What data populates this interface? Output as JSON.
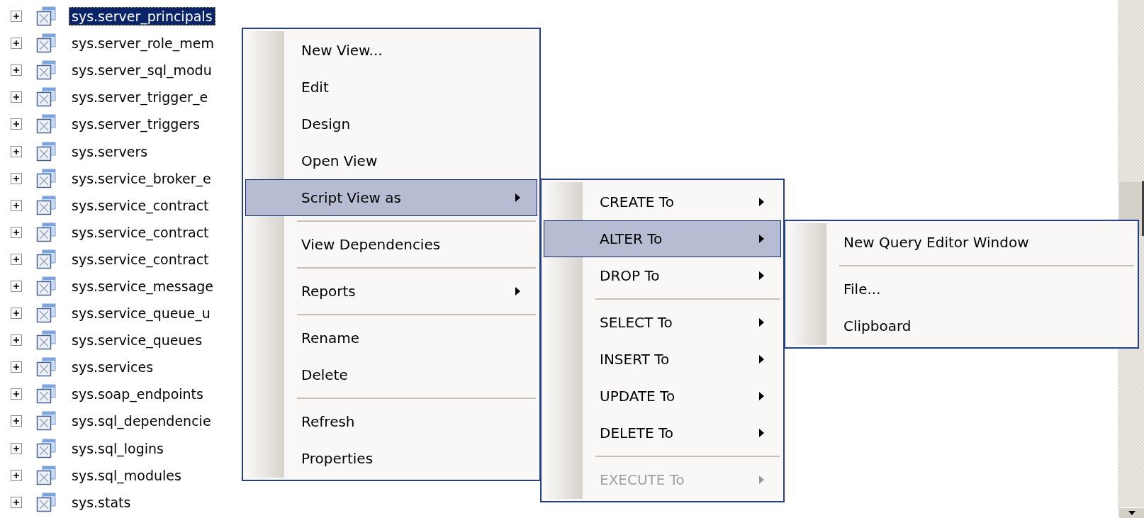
{
  "tree": {
    "rows": [
      {
        "label": "sys.server_principals",
        "selected": true
      },
      {
        "label": "sys.server_role_mem",
        "selected": false
      },
      {
        "label": "sys.server_sql_modu",
        "selected": false
      },
      {
        "label": "sys.server_trigger_e",
        "selected": false
      },
      {
        "label": "sys.server_triggers",
        "selected": false
      },
      {
        "label": "sys.servers",
        "selected": false
      },
      {
        "label": "sys.service_broker_e",
        "selected": false
      },
      {
        "label": "sys.service_contract",
        "selected": false
      },
      {
        "label": "sys.service_contract",
        "selected": false
      },
      {
        "label": "sys.service_contract",
        "selected": false
      },
      {
        "label": "sys.service_message",
        "selected": false
      },
      {
        "label": "sys.service_queue_u",
        "selected": false
      },
      {
        "label": "sys.service_queues",
        "selected": false
      },
      {
        "label": "sys.services",
        "selected": false
      },
      {
        "label": "sys.soap_endpoints",
        "selected": false
      },
      {
        "label": "sys.sql_dependencie",
        "selected": false
      },
      {
        "label": "sys.sql_logins",
        "selected": false
      },
      {
        "label": "sys.sql_modules",
        "selected": false
      },
      {
        "label": "sys.stats",
        "selected": false
      }
    ]
  },
  "context_menu": {
    "items": [
      {
        "kind": "item",
        "label": "New View...",
        "selected": false,
        "disabled": false,
        "has_submenu": false
      },
      {
        "kind": "item",
        "label": "Edit",
        "selected": false,
        "disabled": false,
        "has_submenu": false
      },
      {
        "kind": "item",
        "label": "Design",
        "selected": false,
        "disabled": false,
        "has_submenu": false
      },
      {
        "kind": "item",
        "label": "Open View",
        "selected": false,
        "disabled": false,
        "has_submenu": false
      },
      {
        "kind": "item",
        "label": "Script View as",
        "selected": true,
        "disabled": false,
        "has_submenu": true
      },
      {
        "kind": "separator"
      },
      {
        "kind": "item",
        "label": "View Dependencies",
        "selected": false,
        "disabled": false,
        "has_submenu": false
      },
      {
        "kind": "separator"
      },
      {
        "kind": "item",
        "label": "Reports",
        "selected": false,
        "disabled": false,
        "has_submenu": true
      },
      {
        "kind": "separator"
      },
      {
        "kind": "item",
        "label": "Rename",
        "selected": false,
        "disabled": false,
        "has_submenu": false
      },
      {
        "kind": "item",
        "label": "Delete",
        "selected": false,
        "disabled": false,
        "has_submenu": false
      },
      {
        "kind": "separator"
      },
      {
        "kind": "item",
        "label": "Refresh",
        "selected": false,
        "disabled": false,
        "has_submenu": false
      },
      {
        "kind": "item",
        "label": "Properties",
        "selected": false,
        "disabled": false,
        "has_submenu": false
      }
    ]
  },
  "script_submenu": {
    "items": [
      {
        "kind": "item",
        "label": "CREATE To",
        "selected": false,
        "disabled": false,
        "has_submenu": true
      },
      {
        "kind": "item",
        "label": "ALTER To",
        "selected": true,
        "disabled": false,
        "has_submenu": true
      },
      {
        "kind": "item",
        "label": "DROP To",
        "selected": false,
        "disabled": false,
        "has_submenu": true
      },
      {
        "kind": "separator"
      },
      {
        "kind": "item",
        "label": "SELECT To",
        "selected": false,
        "disabled": false,
        "has_submenu": true
      },
      {
        "kind": "item",
        "label": "INSERT To",
        "selected": false,
        "disabled": false,
        "has_submenu": true
      },
      {
        "kind": "item",
        "label": "UPDATE To",
        "selected": false,
        "disabled": false,
        "has_submenu": true
      },
      {
        "kind": "item",
        "label": "DELETE To",
        "selected": false,
        "disabled": false,
        "has_submenu": true
      },
      {
        "kind": "separator"
      },
      {
        "kind": "item",
        "label": "EXECUTE To",
        "selected": false,
        "disabled": true,
        "has_submenu": true
      }
    ]
  },
  "alter_submenu": {
    "items": [
      {
        "kind": "item",
        "label": "New Query Editor Window",
        "selected": false,
        "disabled": false,
        "has_submenu": false
      },
      {
        "kind": "separator"
      },
      {
        "kind": "item",
        "label": "File...",
        "selected": false,
        "disabled": false,
        "has_submenu": false
      },
      {
        "kind": "item",
        "label": "Clipboard",
        "selected": false,
        "disabled": false,
        "has_submenu": false
      }
    ]
  }
}
